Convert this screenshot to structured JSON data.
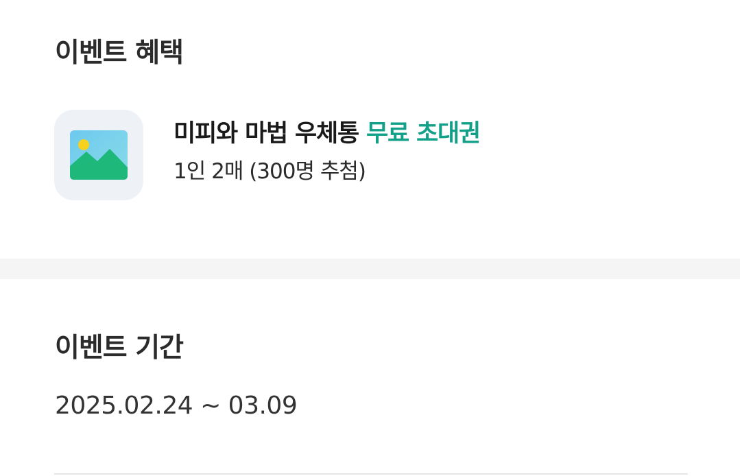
{
  "benefit": {
    "title": "이벤트 혜택",
    "image_icon": "image-placeholder-icon",
    "name_main": "미피와 마법 우체통 ",
    "name_accent": "무료 초대권",
    "description": "1인 2매 (300명 추첨)",
    "accent_color": "#12a089"
  },
  "period": {
    "title": "이벤트 기간",
    "value": "2025.02.24 ~ 03.09"
  }
}
